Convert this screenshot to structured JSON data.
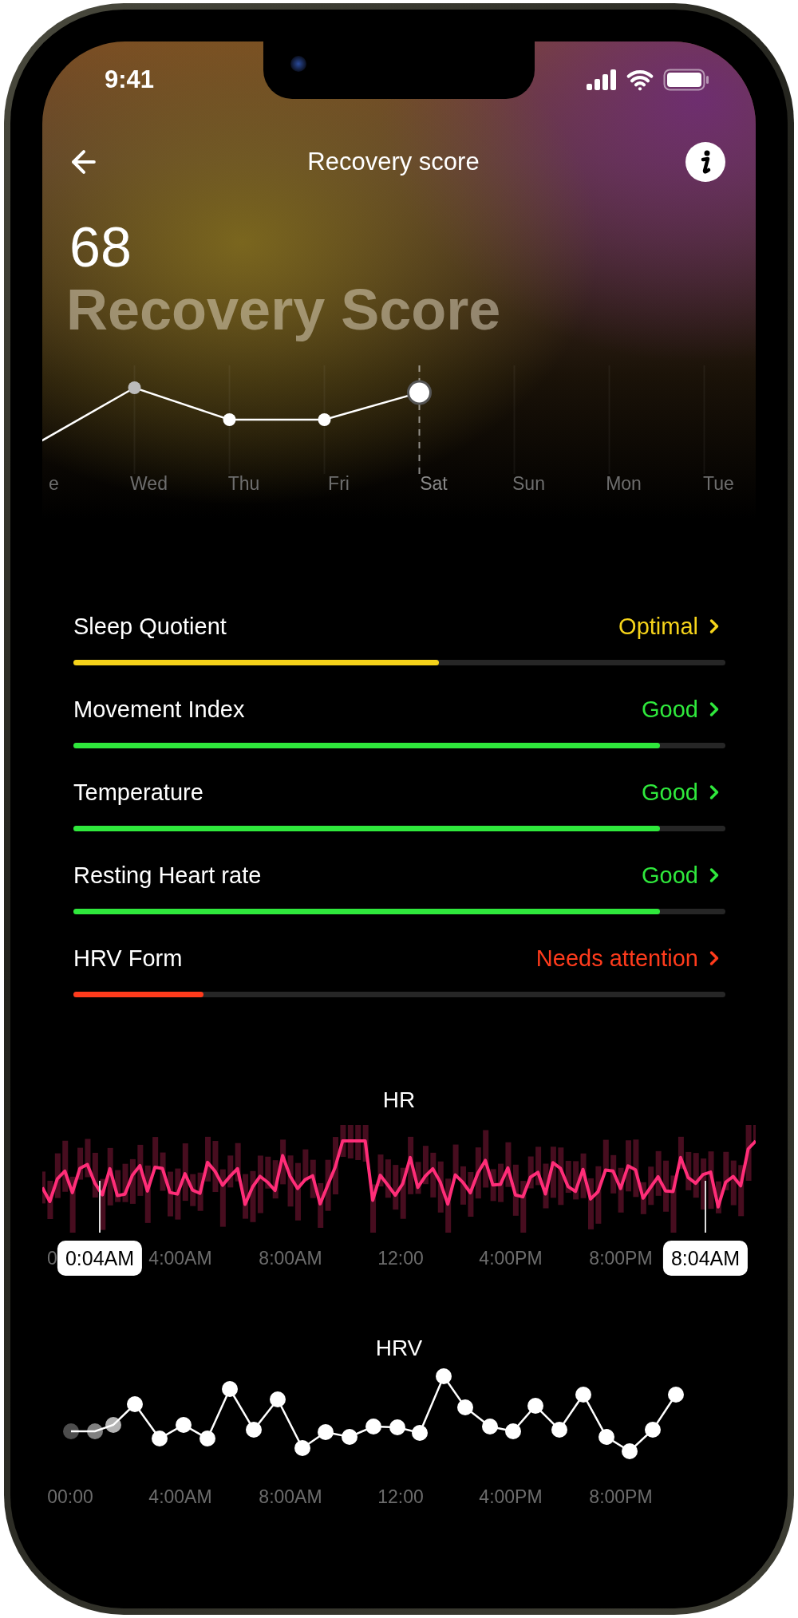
{
  "status_bar": {
    "time": "9:41"
  },
  "header": {
    "title": "Recovery score"
  },
  "score": {
    "value": "68",
    "label": "Recovery Score"
  },
  "week": {
    "days": [
      {
        "label": "e",
        "selected": false
      },
      {
        "label": "Wed",
        "selected": false
      },
      {
        "label": "Thu",
        "selected": false
      },
      {
        "label": "Fri",
        "selected": false
      },
      {
        "label": "Sat",
        "selected": true
      },
      {
        "label": "Sun",
        "selected": false
      },
      {
        "label": "Mon",
        "selected": false
      },
      {
        "label": "Tue",
        "selected": false
      }
    ]
  },
  "metrics": [
    {
      "label": "Sleep Quotient",
      "status": "Optimal",
      "color": "#f5d31a",
      "level": 0.56
    },
    {
      "label": "Movement Index",
      "status": "Good",
      "color": "#2fe83c",
      "level": 0.9
    },
    {
      "label": "Temperature",
      "status": "Good",
      "color": "#2fe83c",
      "level": 0.9
    },
    {
      "label": "Resting Heart rate",
      "status": "Good",
      "color": "#2fe83c",
      "level": 0.9
    },
    {
      "label": "HRV Form",
      "status": "Needs attention",
      "color": "#ff3b1c",
      "level": 0.2
    }
  ],
  "hr_chart": {
    "title": "HR",
    "x_labels": [
      "0",
      "4:00AM",
      "8:00AM",
      "12:00",
      "4:00PM",
      "8:00PM"
    ],
    "tooltips": [
      "0:04AM",
      "8:04AM"
    ]
  },
  "hrv_chart": {
    "title": "HRV",
    "x_labels": [
      "00:00",
      "4:00AM",
      "8:00AM",
      "12:00",
      "4:00PM",
      "8:00PM"
    ]
  }
}
